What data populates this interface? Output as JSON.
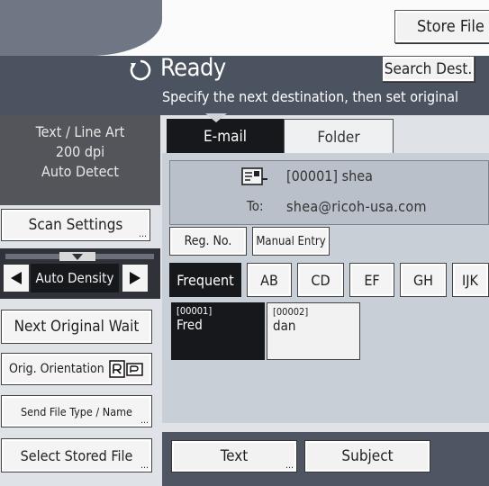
{
  "header": {
    "store_file_label": "Store File",
    "status": "Ready",
    "search_dest_label": "Search Dest.",
    "instruction": "Specify the next destination, then set original"
  },
  "scan_info": {
    "line1": "Text / Line Art",
    "line2": "200 dpi",
    "line3": "Auto Detect"
  },
  "left_buttons": {
    "scan_settings": "Scan Settings",
    "auto_density": "Auto Density",
    "next_original_wait": "Next Original Wait",
    "orig_orientation": "Orig. Orientation",
    "send_file_type": "Send File Type / Name",
    "select_stored_file": "Select Stored File"
  },
  "tabs": [
    {
      "label": "E-mail",
      "active": true
    },
    {
      "label": "Folder",
      "active": false
    }
  ],
  "destination": {
    "name": "[00001] shea",
    "to_label": "To:",
    "to_value": "shea@ricoh-usa.com"
  },
  "entry_buttons": {
    "reg_no": "Reg. No.",
    "manual_entry": "Manual Entry"
  },
  "index_tabs": [
    "Frequent",
    "AB",
    "CD",
    "EF",
    "GH",
    "IJK"
  ],
  "entries": [
    {
      "code": "[00001]",
      "name": "Fred",
      "selected": true
    },
    {
      "code": "[00002]",
      "name": "dan",
      "selected": false
    }
  ],
  "bottom_buttons": {
    "text": "Text",
    "subject": "Subject"
  },
  "colors": {
    "dark_bar": "#4b5260",
    "selected": "#17181c",
    "panel": "#c9cfd7"
  }
}
